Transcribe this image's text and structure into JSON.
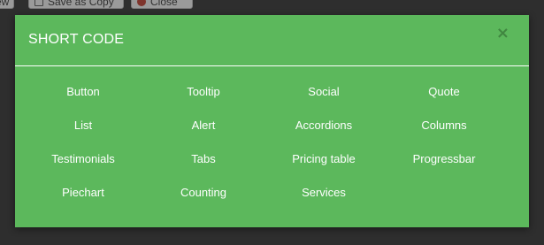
{
  "background_toolbar": {
    "view_label": "ew",
    "save_copy_label": "Save as Copy",
    "close_label": "Close"
  },
  "modal": {
    "title": "SHORT CODE",
    "close_symbol": "×",
    "items": [
      {
        "label": "Button"
      },
      {
        "label": "Tooltip"
      },
      {
        "label": "Social"
      },
      {
        "label": "Quote"
      },
      {
        "label": "List"
      },
      {
        "label": "Alert"
      },
      {
        "label": "Accordions"
      },
      {
        "label": "Columns"
      },
      {
        "label": "Testimonials"
      },
      {
        "label": "Tabs"
      },
      {
        "label": "Pricing table"
      },
      {
        "label": "Progressbar"
      },
      {
        "label": "Piechart"
      },
      {
        "label": "Counting"
      },
      {
        "label": "Services"
      }
    ]
  },
  "colors": {
    "modal_background": "#5cb85c",
    "text": "#ffffff",
    "page_background": "#2e2e2e"
  },
  "icons": {
    "copy": "copy-icon",
    "close": "close-circle-icon",
    "modal_close": "close-icon"
  }
}
